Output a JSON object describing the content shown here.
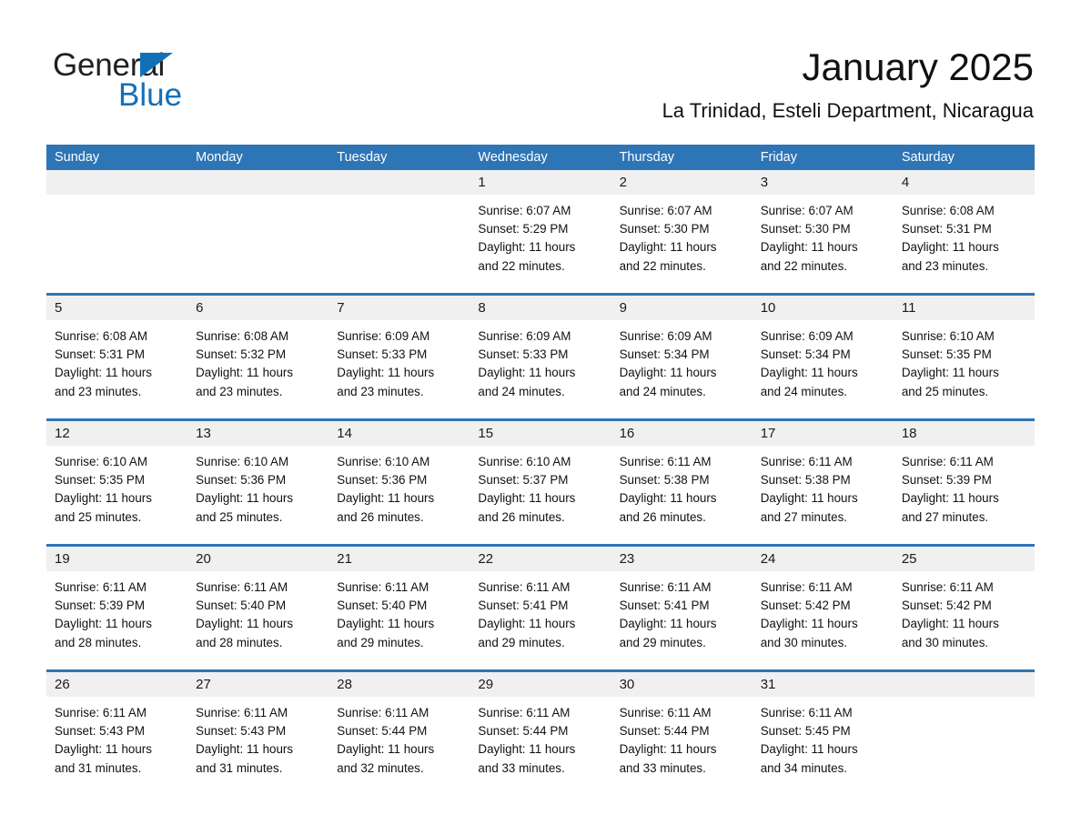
{
  "brand": {
    "name_part1": "General",
    "name_part2": "Blue",
    "flag_icon": "brand-flag-icon",
    "accent_color": "#1270b8"
  },
  "header": {
    "title": "January 2025",
    "location": "La Trinidad, Esteli Department, Nicaragua"
  },
  "calendar": {
    "header_color": "#2e75b6",
    "daynum_band_color": "#f0f0f0",
    "weekdays": [
      "Sunday",
      "Monday",
      "Tuesday",
      "Wednesday",
      "Thursday",
      "Friday",
      "Saturday"
    ],
    "weeks": [
      [
        {
          "day": "",
          "empty": true
        },
        {
          "day": "",
          "empty": true
        },
        {
          "day": "",
          "empty": true
        },
        {
          "day": "1",
          "sunrise": "Sunrise: 6:07 AM",
          "sunset": "Sunset: 5:29 PM",
          "daylight_line1": "Daylight: 11 hours",
          "daylight_line2": "and 22 minutes."
        },
        {
          "day": "2",
          "sunrise": "Sunrise: 6:07 AM",
          "sunset": "Sunset: 5:30 PM",
          "daylight_line1": "Daylight: 11 hours",
          "daylight_line2": "and 22 minutes."
        },
        {
          "day": "3",
          "sunrise": "Sunrise: 6:07 AM",
          "sunset": "Sunset: 5:30 PM",
          "daylight_line1": "Daylight: 11 hours",
          "daylight_line2": "and 22 minutes."
        },
        {
          "day": "4",
          "sunrise": "Sunrise: 6:08 AM",
          "sunset": "Sunset: 5:31 PM",
          "daylight_line1": "Daylight: 11 hours",
          "daylight_line2": "and 23 minutes."
        }
      ],
      [
        {
          "day": "5",
          "sunrise": "Sunrise: 6:08 AM",
          "sunset": "Sunset: 5:31 PM",
          "daylight_line1": "Daylight: 11 hours",
          "daylight_line2": "and 23 minutes."
        },
        {
          "day": "6",
          "sunrise": "Sunrise: 6:08 AM",
          "sunset": "Sunset: 5:32 PM",
          "daylight_line1": "Daylight: 11 hours",
          "daylight_line2": "and 23 minutes."
        },
        {
          "day": "7",
          "sunrise": "Sunrise: 6:09 AM",
          "sunset": "Sunset: 5:33 PM",
          "daylight_line1": "Daylight: 11 hours",
          "daylight_line2": "and 23 minutes."
        },
        {
          "day": "8",
          "sunrise": "Sunrise: 6:09 AM",
          "sunset": "Sunset: 5:33 PM",
          "daylight_line1": "Daylight: 11 hours",
          "daylight_line2": "and 24 minutes."
        },
        {
          "day": "9",
          "sunrise": "Sunrise: 6:09 AM",
          "sunset": "Sunset: 5:34 PM",
          "daylight_line1": "Daylight: 11 hours",
          "daylight_line2": "and 24 minutes."
        },
        {
          "day": "10",
          "sunrise": "Sunrise: 6:09 AM",
          "sunset": "Sunset: 5:34 PM",
          "daylight_line1": "Daylight: 11 hours",
          "daylight_line2": "and 24 minutes."
        },
        {
          "day": "11",
          "sunrise": "Sunrise: 6:10 AM",
          "sunset": "Sunset: 5:35 PM",
          "daylight_line1": "Daylight: 11 hours",
          "daylight_line2": "and 25 minutes."
        }
      ],
      [
        {
          "day": "12",
          "sunrise": "Sunrise: 6:10 AM",
          "sunset": "Sunset: 5:35 PM",
          "daylight_line1": "Daylight: 11 hours",
          "daylight_line2": "and 25 minutes."
        },
        {
          "day": "13",
          "sunrise": "Sunrise: 6:10 AM",
          "sunset": "Sunset: 5:36 PM",
          "daylight_line1": "Daylight: 11 hours",
          "daylight_line2": "and 25 minutes."
        },
        {
          "day": "14",
          "sunrise": "Sunrise: 6:10 AM",
          "sunset": "Sunset: 5:36 PM",
          "daylight_line1": "Daylight: 11 hours",
          "daylight_line2": "and 26 minutes."
        },
        {
          "day": "15",
          "sunrise": "Sunrise: 6:10 AM",
          "sunset": "Sunset: 5:37 PM",
          "daylight_line1": "Daylight: 11 hours",
          "daylight_line2": "and 26 minutes."
        },
        {
          "day": "16",
          "sunrise": "Sunrise: 6:11 AM",
          "sunset": "Sunset: 5:38 PM",
          "daylight_line1": "Daylight: 11 hours",
          "daylight_line2": "and 26 minutes."
        },
        {
          "day": "17",
          "sunrise": "Sunrise: 6:11 AM",
          "sunset": "Sunset: 5:38 PM",
          "daylight_line1": "Daylight: 11 hours",
          "daylight_line2": "and 27 minutes."
        },
        {
          "day": "18",
          "sunrise": "Sunrise: 6:11 AM",
          "sunset": "Sunset: 5:39 PM",
          "daylight_line1": "Daylight: 11 hours",
          "daylight_line2": "and 27 minutes."
        }
      ],
      [
        {
          "day": "19",
          "sunrise": "Sunrise: 6:11 AM",
          "sunset": "Sunset: 5:39 PM",
          "daylight_line1": "Daylight: 11 hours",
          "daylight_line2": "and 28 minutes."
        },
        {
          "day": "20",
          "sunrise": "Sunrise: 6:11 AM",
          "sunset": "Sunset: 5:40 PM",
          "daylight_line1": "Daylight: 11 hours",
          "daylight_line2": "and 28 minutes."
        },
        {
          "day": "21",
          "sunrise": "Sunrise: 6:11 AM",
          "sunset": "Sunset: 5:40 PM",
          "daylight_line1": "Daylight: 11 hours",
          "daylight_line2": "and 29 minutes."
        },
        {
          "day": "22",
          "sunrise": "Sunrise: 6:11 AM",
          "sunset": "Sunset: 5:41 PM",
          "daylight_line1": "Daylight: 11 hours",
          "daylight_line2": "and 29 minutes."
        },
        {
          "day": "23",
          "sunrise": "Sunrise: 6:11 AM",
          "sunset": "Sunset: 5:41 PM",
          "daylight_line1": "Daylight: 11 hours",
          "daylight_line2": "and 29 minutes."
        },
        {
          "day": "24",
          "sunrise": "Sunrise: 6:11 AM",
          "sunset": "Sunset: 5:42 PM",
          "daylight_line1": "Daylight: 11 hours",
          "daylight_line2": "and 30 minutes."
        },
        {
          "day": "25",
          "sunrise": "Sunrise: 6:11 AM",
          "sunset": "Sunset: 5:42 PM",
          "daylight_line1": "Daylight: 11 hours",
          "daylight_line2": "and 30 minutes."
        }
      ],
      [
        {
          "day": "26",
          "sunrise": "Sunrise: 6:11 AM",
          "sunset": "Sunset: 5:43 PM",
          "daylight_line1": "Daylight: 11 hours",
          "daylight_line2": "and 31 minutes."
        },
        {
          "day": "27",
          "sunrise": "Sunrise: 6:11 AM",
          "sunset": "Sunset: 5:43 PM",
          "daylight_line1": "Daylight: 11 hours",
          "daylight_line2": "and 31 minutes."
        },
        {
          "day": "28",
          "sunrise": "Sunrise: 6:11 AM",
          "sunset": "Sunset: 5:44 PM",
          "daylight_line1": "Daylight: 11 hours",
          "daylight_line2": "and 32 minutes."
        },
        {
          "day": "29",
          "sunrise": "Sunrise: 6:11 AM",
          "sunset": "Sunset: 5:44 PM",
          "daylight_line1": "Daylight: 11 hours",
          "daylight_line2": "and 33 minutes."
        },
        {
          "day": "30",
          "sunrise": "Sunrise: 6:11 AM",
          "sunset": "Sunset: 5:44 PM",
          "daylight_line1": "Daylight: 11 hours",
          "daylight_line2": "and 33 minutes."
        },
        {
          "day": "31",
          "sunrise": "Sunrise: 6:11 AM",
          "sunset": "Sunset: 5:45 PM",
          "daylight_line1": "Daylight: 11 hours",
          "daylight_line2": "and 34 minutes."
        },
        {
          "day": "",
          "empty": true
        }
      ]
    ]
  }
}
